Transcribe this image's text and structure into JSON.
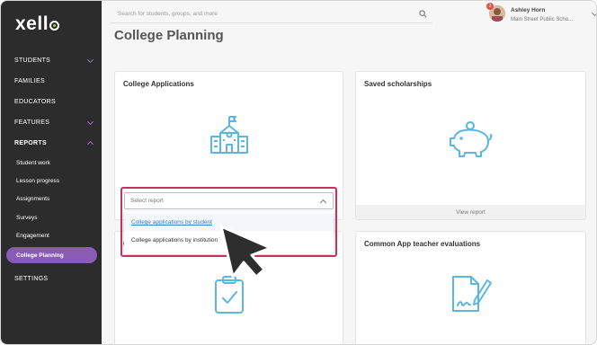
{
  "logo": {
    "text": "xell"
  },
  "sidebar": {
    "items": [
      {
        "label": "STUDENTS",
        "expandable": true
      },
      {
        "label": "FAMILIES"
      },
      {
        "label": "EDUCATORS"
      },
      {
        "label": "FEATURES",
        "expandable": true
      },
      {
        "label": "REPORTS",
        "expanded": true
      }
    ],
    "reports_sub": [
      {
        "label": "Student work"
      },
      {
        "label": "Lesson progress"
      },
      {
        "label": "Assignments"
      },
      {
        "label": "Surveys"
      },
      {
        "label": "Engagement"
      },
      {
        "label": "College Planning",
        "active": true
      }
    ],
    "settings": "SETTINGS"
  },
  "search": {
    "placeholder": "Search for students, groups, and more"
  },
  "user": {
    "name": "Ashley Horn",
    "school": "Main Street Public Scho...",
    "badge": "2"
  },
  "page": {
    "title": "College Planning"
  },
  "cards": {
    "college_applications": {
      "title": "College Applications",
      "icon": "school-building-icon"
    },
    "saved_scholarships": {
      "title": "Saved scholarships",
      "icon": "piggy-bank-icon",
      "footer": "View report"
    },
    "common_app": {
      "title": "Common App teacher evaluations",
      "icon": "signed-document-icon"
    },
    "hidden_card": {
      "partial_title": "C",
      "icon": "clipboard-check-icon"
    }
  },
  "dropdown": {
    "placeholder": "Select report",
    "options": [
      {
        "label": "College applications by student"
      },
      {
        "label": "College applications by institution"
      }
    ]
  },
  "colors": {
    "sidebar_bg": "#2c2c2c",
    "accent_purple": "#8a5bb5",
    "icon_blue": "#5bb7dd",
    "highlight_red": "#c8325a",
    "link_blue": "#3c7bc4"
  }
}
